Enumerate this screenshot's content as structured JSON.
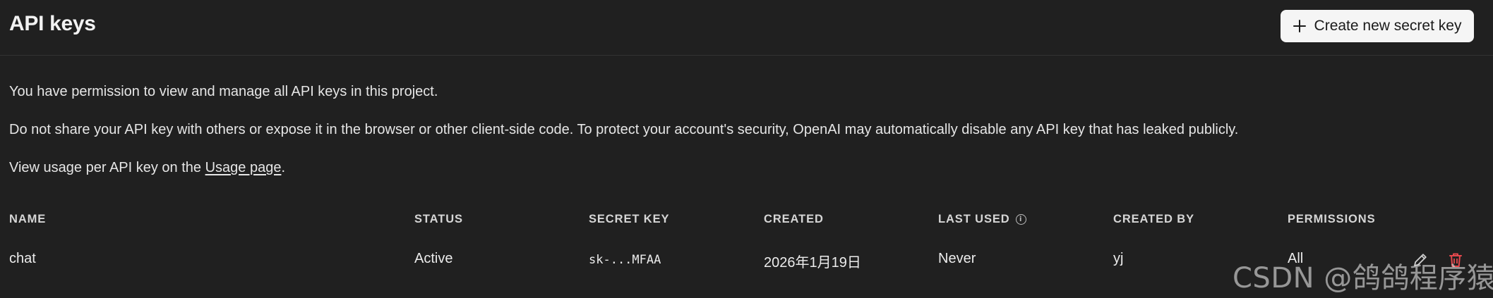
{
  "header": {
    "title": "API keys",
    "create_button_label": "Create new secret key"
  },
  "intro": {
    "permission_text": "You have permission to view and manage all API keys in this project.",
    "warning_text": "Do not share your API key with others or expose it in the browser or other client-side code. To protect your account's security, OpenAI may automatically disable any API key that has leaked publicly.",
    "usage_prefix": "View usage per API key on the ",
    "usage_link": "Usage page",
    "usage_suffix": "."
  },
  "table": {
    "columns": [
      "NAME",
      "STATUS",
      "SECRET KEY",
      "CREATED",
      "LAST USED",
      "CREATED BY",
      "PERMISSIONS"
    ],
    "rows": [
      {
        "name": "chat",
        "status": "Active",
        "secret_key": "sk-...MFAA",
        "created": "2026年1月19日",
        "last_used": "Never",
        "created_by": "yj",
        "permissions": "All",
        "actions": [
          "edit-icon",
          "delete-icon"
        ]
      }
    ]
  },
  "watermark": "CSDN @鸽鸽程序猿",
  "colors": {
    "background": "#202020",
    "text": "#ececec",
    "button_bg": "#f5f5f5",
    "delete_icon": "#e5484d"
  }
}
